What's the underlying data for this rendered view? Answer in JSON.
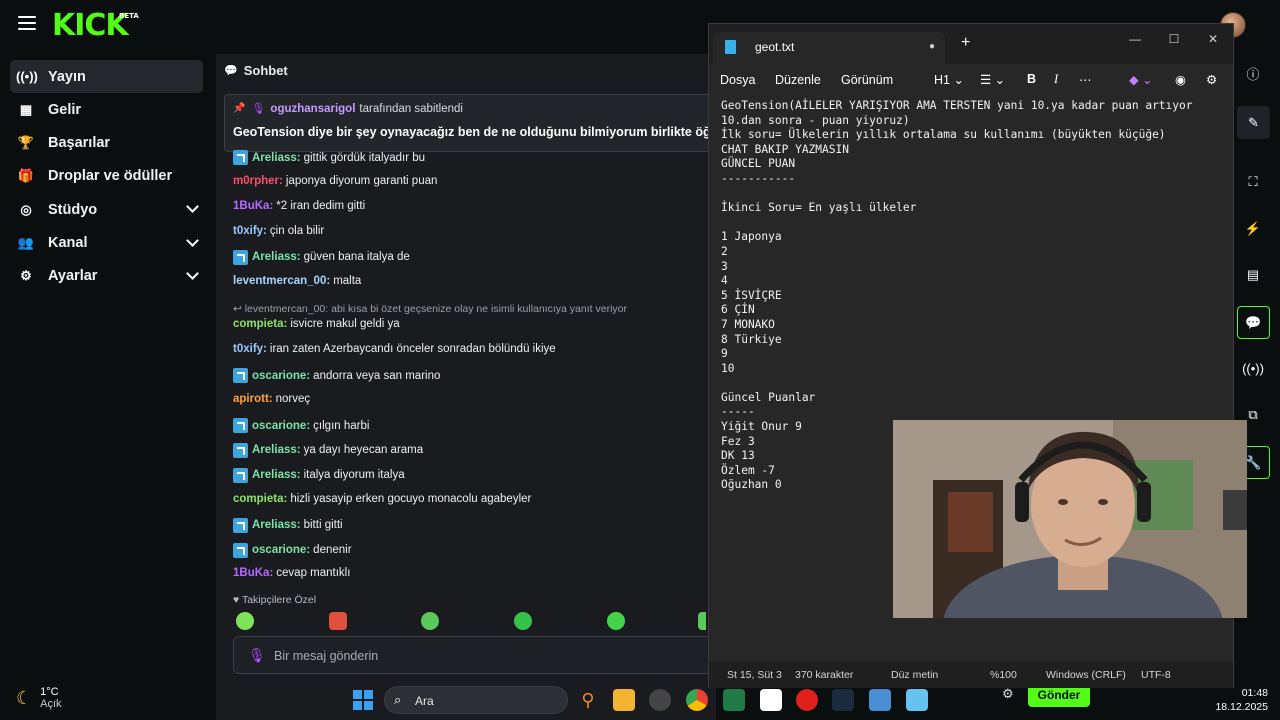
{
  "kick": {
    "logo_text": "KICK",
    "logo_badge": "BETA",
    "sidebar": [
      {
        "label": "Yayın",
        "icon": "broadcast-icon",
        "glyph": "((•))",
        "active": true,
        "chevron": false
      },
      {
        "label": "Gelir",
        "icon": "revenue-icon",
        "glyph": "▦",
        "active": false,
        "chevron": false
      },
      {
        "label": "Başarılar",
        "icon": "trophy-icon",
        "glyph": "🏆",
        "active": false,
        "chevron": false
      },
      {
        "label": "Droplar ve ödüller",
        "icon": "gift-icon",
        "glyph": "🎁",
        "active": false,
        "chevron": false
      },
      {
        "label": "Stüdyo",
        "icon": "studio-icon",
        "glyph": "◎",
        "active": false,
        "chevron": true
      },
      {
        "label": "Kanal",
        "icon": "channel-icon",
        "glyph": "👥",
        "active": false,
        "chevron": true
      },
      {
        "label": "Ayarlar",
        "icon": "settings-icon",
        "glyph": "⚙",
        "active": false,
        "chevron": true
      }
    ]
  },
  "weather": {
    "temp": "1°C",
    "condition": "Açık"
  },
  "chat": {
    "title": "Sohbet",
    "pinned": {
      "user": "oguzhansarigol",
      "suffix": "tarafından sabitlendi",
      "message": "GeoTension diye bir şey oynayacağız ben de ne olduğunu bilmiyorum birlikte öğrenic"
    },
    "messages": [
      {
        "user": "Areliass",
        "color": "#7ee3a8",
        "badge": true,
        "text": "gittik gördük italyadır bu"
      },
      {
        "user": "m0rpher",
        "color": "#ff4d6d",
        "badge": false,
        "text": "japonya diyorum garanti puan"
      },
      {
        "user": "1BuKa",
        "color": "#b86bff",
        "badge": false,
        "text": "*2 iran dedim gitti"
      },
      {
        "user": "t0xify",
        "color": "#9bc8ff",
        "badge": false,
        "text": "çin ola bilir"
      },
      {
        "user": "Areliass",
        "color": "#7ee3a8",
        "badge": true,
        "text": "güven bana italya de"
      },
      {
        "user": "leventmercan_00",
        "color": "#a8d4ff",
        "badge": false,
        "text": "malta"
      },
      {
        "reply": "leventmercan_00: abi kısa bi özet geçsenize olay ne isimli kullanıcıya yanıt veriyor"
      },
      {
        "user": "compieta",
        "color": "#8fe36b",
        "badge": false,
        "text": "isvicre makul geldi ya"
      },
      {
        "user": "t0xify",
        "color": "#9bc8ff",
        "badge": false,
        "text": "iran zaten Azerbaycandı önceler sonradan bölündü ikiye"
      },
      {
        "user": "oscarione",
        "color": "#7ee3a8",
        "badge": true,
        "text": "andorra veya san marino"
      },
      {
        "user": "apirott",
        "color": "#ff9f3f",
        "badge": false,
        "text": "norveç"
      },
      {
        "user": "oscarione",
        "color": "#7ee3a8",
        "badge": true,
        "text": "çılgın harbi"
      },
      {
        "user": "Areliass",
        "color": "#7ee3a8",
        "badge": true,
        "text": "ya dayı heyecan arama"
      },
      {
        "user": "Areliass",
        "color": "#7ee3a8",
        "badge": true,
        "text": "italya diyorum italya"
      },
      {
        "user": "compieta",
        "color": "#8fe36b",
        "badge": false,
        "text": "hizli yasayip erken gocuyo monacolu agabeyler"
      },
      {
        "user": "Areliass",
        "color": "#7ee3a8",
        "badge": true,
        "text": "bitti gitti"
      },
      {
        "user": "oscarione",
        "color": "#7ee3a8",
        "badge": true,
        "text": "denenir"
      },
      {
        "user": "1BuKa",
        "color": "#b86bff",
        "badge": false,
        "text": "cevap mantıklı"
      }
    ],
    "followers_label": "Takipçilere Özel",
    "input_placeholder": "Bir mesaj gönderin",
    "send_label": "Gönder"
  },
  "notepad": {
    "tab_name": "geot.txt",
    "menu": [
      "Dosya",
      "Düzenle",
      "Görünüm"
    ],
    "heading_tool": "H1",
    "content_lines": [
      "GeoTension(AİLELER YARIŞIYOR AMA TERSTEN yani 10.ya kadar puan artıyor",
      "10.dan sonra - puan yiyoruz)",
      "İlk soru= Ülkelerin yıllık ortalama su kullanımı (büyükten küçüğe)",
      "CHAT BAKIP YAZMASIN",
      "GÜNCEL PUAN",
      "-----------",
      "",
      "İkinci Soru= En yaşlı ülkeler",
      "",
      "1 Japonya",
      "2",
      "3",
      "4",
      "5 İSVİÇRE",
      "6 ÇİN",
      "7 MONAKO",
      "8 Türkiye",
      "9",
      "10",
      "",
      "Güncel Puanlar",
      "-----",
      "Yiğit Onur 9",
      "Fez 3",
      "DK 13",
      "Özlem -7",
      "Oğuzhan 0"
    ],
    "status": {
      "position": "St 15, Süt 3",
      "chars": "370 karakter",
      "format": "Düz metin",
      "zoom": "%100",
      "line_ending": "Windows (CRLF)",
      "encoding": "UTF-8"
    }
  },
  "taskbar": {
    "search_label": "Ara",
    "time": "01:48",
    "date": "18.12.2025"
  },
  "colors": {
    "accent": "#53fc18",
    "chat_bg": "#191b1f",
    "notepad_bg": "#272727"
  }
}
